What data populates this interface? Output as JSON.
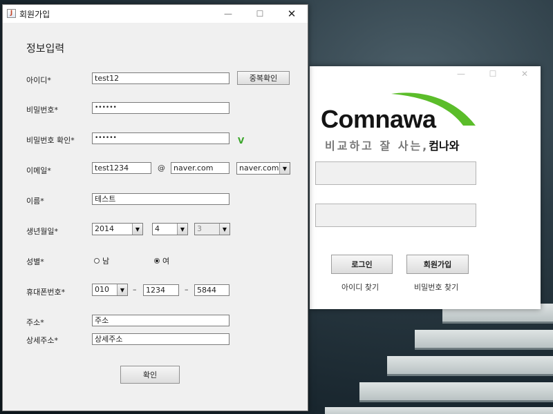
{
  "login": {
    "logo": "Comnawa",
    "slogan_light": "비교하고 잘 사는,",
    "slogan_bold": "컴나와",
    "login_button": "로그인",
    "signup_button": "회원가입",
    "find_id": "아이디 찾기",
    "find_pw": "비밀번호 찾기",
    "accent_color": "#5bbd2a"
  },
  "signup": {
    "window_title": "회원가입",
    "heading": "정보입력",
    "fields": {
      "id": {
        "label": "아이디*",
        "value": "test12",
        "check_button": "중복확인"
      },
      "password": {
        "label": "비밀번호*",
        "value": "••••••"
      },
      "password_confirm": {
        "label": "비밀번호 확인*",
        "value": "••••••",
        "check_mark": "V"
      },
      "email": {
        "label": "이메일*",
        "local": "test1234",
        "at": "@",
        "domain": "naver.com",
        "domain_select": "naver.com"
      },
      "name": {
        "label": "이름*",
        "value": "테스트"
      },
      "birth": {
        "label": "생년월일*",
        "year": "2014",
        "month": "4",
        "day": "3"
      },
      "gender": {
        "label": "성별*",
        "male": "남",
        "female": "여",
        "selected": "female"
      },
      "phone": {
        "label": "휴대폰번호*",
        "prefix": "010",
        "dash": "–",
        "middle": "1234",
        "last": "5844"
      },
      "address": {
        "label": "주소*",
        "value": "주소"
      },
      "address_detail": {
        "label": "상세주소*",
        "value": "상세주소"
      }
    },
    "confirm_button": "확인"
  },
  "icons": {
    "minimize": "—",
    "maximize": "☐",
    "close": "✕",
    "dropdown": "▼"
  }
}
